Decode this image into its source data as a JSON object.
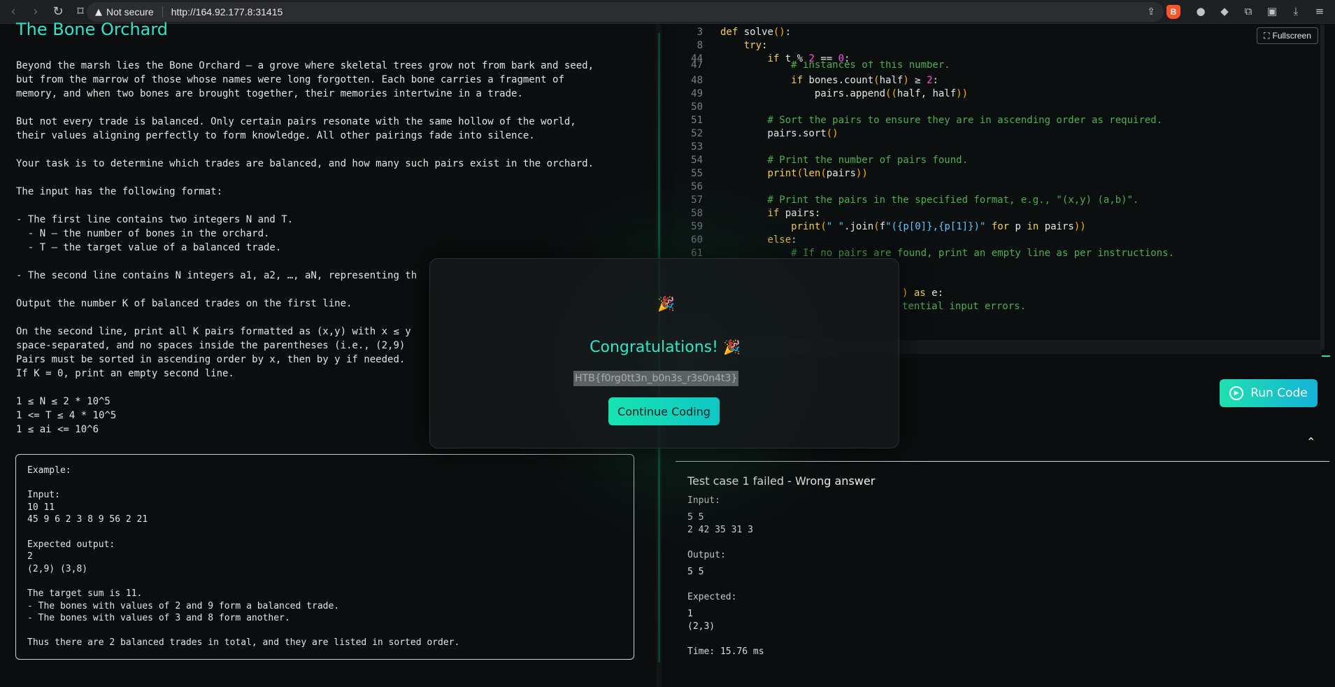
{
  "browser": {
    "security_label": "Not secure",
    "url": "http://164.92.177.8:31415",
    "icons": [
      "back-icon",
      "forward-icon",
      "reload-icon",
      "bookmark-icon",
      "share-icon",
      "brave-icon",
      "extension-icon",
      "puzzle-icon",
      "sidebar-icon",
      "download-icon",
      "menu-icon"
    ]
  },
  "problem": {
    "title": "The Bone Orchard",
    "body": "Beyond the marsh lies the Bone Orchard — a grove where skeletal trees grow not from bark and seed,\nbut from the marrow of those whose names were long forgotten. Each bone carries a fragment of\nmemory, and when two bones are brought together, their memories intertwine in a trade.\n\nBut not every trade is balanced. Only certain pairs resonate with the same hollow of the world,\ntheir values aligning perfectly to form knowledge. All other pairings fade into silence.\n\nYour task is to determine which trades are balanced, and how many such pairs exist in the orchard.\n\nThe input has the following format:\n\n- The first line contains two integers N and T.\n  - N — the number of bones in the orchard.\n  - T — the target value of a balanced trade.\n\n- The second line contains N integers a1, a2, …, aN, representing th\n\nOutput the number K of balanced trades on the first line.\n\nOn the second line, print all K pairs formatted as (x,y) with x ≤ y\nspace-separated, and no spaces inside the parentheses (i.e., (2,9)\nPairs must be sorted in ascending order by x, then by y if needed.\nIf K = 0, print an empty second line.\n\n1 ≤ N ≤ 2 * 10^5\n1 <= T ≤ 4 * 10^5\n1 ≤ ai <= 10^6",
    "example": "Example:\n\nInput:\n10 11\n45 9 6 2 3 8 9 56 2 21\n\nExpected output:\n2\n(2,9) (3,8)\n\nThe target sum is 11.\n- The bones with values of 2 and 9 form a balanced trade.\n- The bones with values of 3 and 8 form another.\n\nThus there are 2 balanced trades in total, and they are listed in sorted order."
  },
  "editor": {
    "fullscreen_label": "Fullscreen",
    "run_label": "Run Code",
    "line_numbers": [
      "3",
      "8",
      "44",
      "47",
      "48",
      "49",
      "50",
      "51",
      "52",
      "53",
      "54",
      "55",
      "56",
      "57",
      "58",
      "59",
      "60",
      "61"
    ]
  },
  "results": {
    "heading": "Test case 1 failed - Wrong answer",
    "input_label": "Input:",
    "input_value": "5 5\n2 42 35 31 3",
    "output_label": "Output:",
    "output_value": "5 5",
    "expected_label": "Expected:",
    "expected_value": "1\n(2,3)",
    "time": "Time: 15.76 ms"
  },
  "modal": {
    "title": "Congratulations!",
    "flag": "HTB{f0rg0tt3n_b0n3s_r3s0n4t3}",
    "button": "Continue Coding"
  }
}
